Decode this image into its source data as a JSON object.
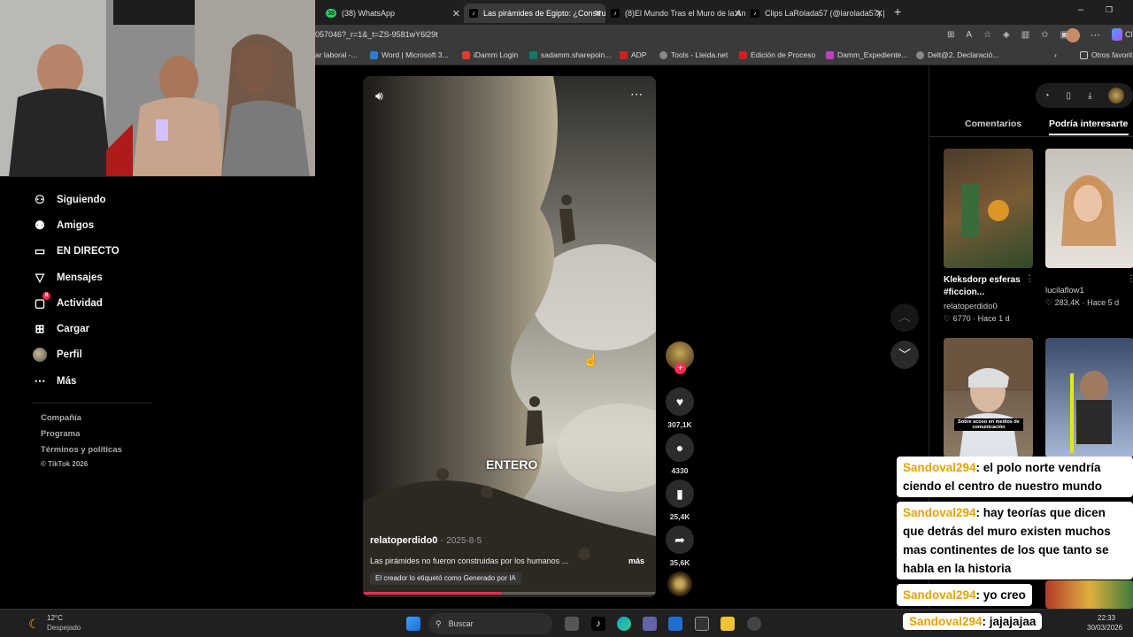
{
  "browser": {
    "tabs": [
      {
        "label": "(38) WhatsApp",
        "badge": "38",
        "active": false
      },
      {
        "label": "Las pirámides de Egipto: ¿Constru",
        "active": true
      },
      {
        "label": "(8)El Mundo Tras el Muro de la An",
        "active": false
      },
      {
        "label": "Clips LaRolada57 (@larolada57) | T",
        "active": false
      }
    ],
    "url": "057046?_r=1&_t=ZS-9581wY6l29t",
    "bookmarks": [
      "ar laboral -...",
      "Word | Microsoft 3...",
      "iDamm Login",
      "sadamm.sharepoin...",
      "ADP",
      "Tools - Lleida.net",
      "Edición de Proceso",
      "Damm_Expediente...",
      "Delt@2. Declaració..."
    ],
    "other_bookmarks": "Otros favorit",
    "profile_partial": "Cl"
  },
  "sidebar": {
    "items": [
      {
        "label": "Siguiendo",
        "icon": "following-icon"
      },
      {
        "label": "Amigos",
        "icon": "friends-icon"
      },
      {
        "label": "EN DIRECTO",
        "icon": "live-icon"
      },
      {
        "label": "Mensajes",
        "icon": "messages-icon"
      },
      {
        "label": "Actividad",
        "icon": "activity-icon",
        "badge": "8"
      },
      {
        "label": "Cargar",
        "icon": "upload-icon"
      },
      {
        "label": "Perfil",
        "icon": "avatar"
      },
      {
        "label": "Más",
        "icon": "more-icon"
      }
    ],
    "footer": [
      "Compañía",
      "Programa",
      "Términos y políticas",
      "© TikTok 2026"
    ]
  },
  "video": {
    "caption_overlay": "ENTERO",
    "author": "relatoperdido0",
    "date": "2025-8-5",
    "description": "Las pirámides no fueron construidas por los humanos ...",
    "more": "más",
    "ai_label": "El creador lo etiquetó como Generado por IA",
    "progress": 0.47
  },
  "actions": {
    "likes": "307,1K",
    "comments": "4330",
    "saves": "25,4K",
    "shares": "35,6K"
  },
  "right_panel": {
    "tabs": [
      "Comentarios",
      "Podría interesarte"
    ],
    "videos": [
      {
        "title": "Kleksdorp esferas #ficcion...",
        "author": "relatoperdido0",
        "likes": "6770",
        "age": "Hace 1 d"
      },
      {
        "title": "",
        "author": "lucilaflow1",
        "likes": "283,4K",
        "age": "Hace 5 d"
      },
      {
        "title": "",
        "author": "",
        "likes": "",
        "age": "",
        "thumb_text": "Sobre acoso en medios de comunicación"
      },
      {
        "title": "",
        "author": "",
        "likes": "",
        "age": ""
      }
    ]
  },
  "chat": [
    {
      "user": "Sandoval294",
      "text": ": el polo norte vendría ciendo el centro de nuestro mundo"
    },
    {
      "user": "Sandoval294",
      "text": ": hay teorías que dicen que detrás del muro existen muchos mas continentes de los que tanto se habla en la historia"
    },
    {
      "user": "Sandoval294",
      "text": ": yo creo"
    },
    {
      "user": "Sandoval294",
      "text": ": jajajajaa"
    }
  ],
  "taskbar": {
    "weather_temp": "12°C",
    "weather_desc": "Despejado",
    "search": "Buscar",
    "time": "22:33",
    "date": "30/03/2026"
  },
  "colors": {
    "accent_red": "#fe2c55",
    "chat_user": "#e6a300",
    "progress": "#fe2c55"
  }
}
